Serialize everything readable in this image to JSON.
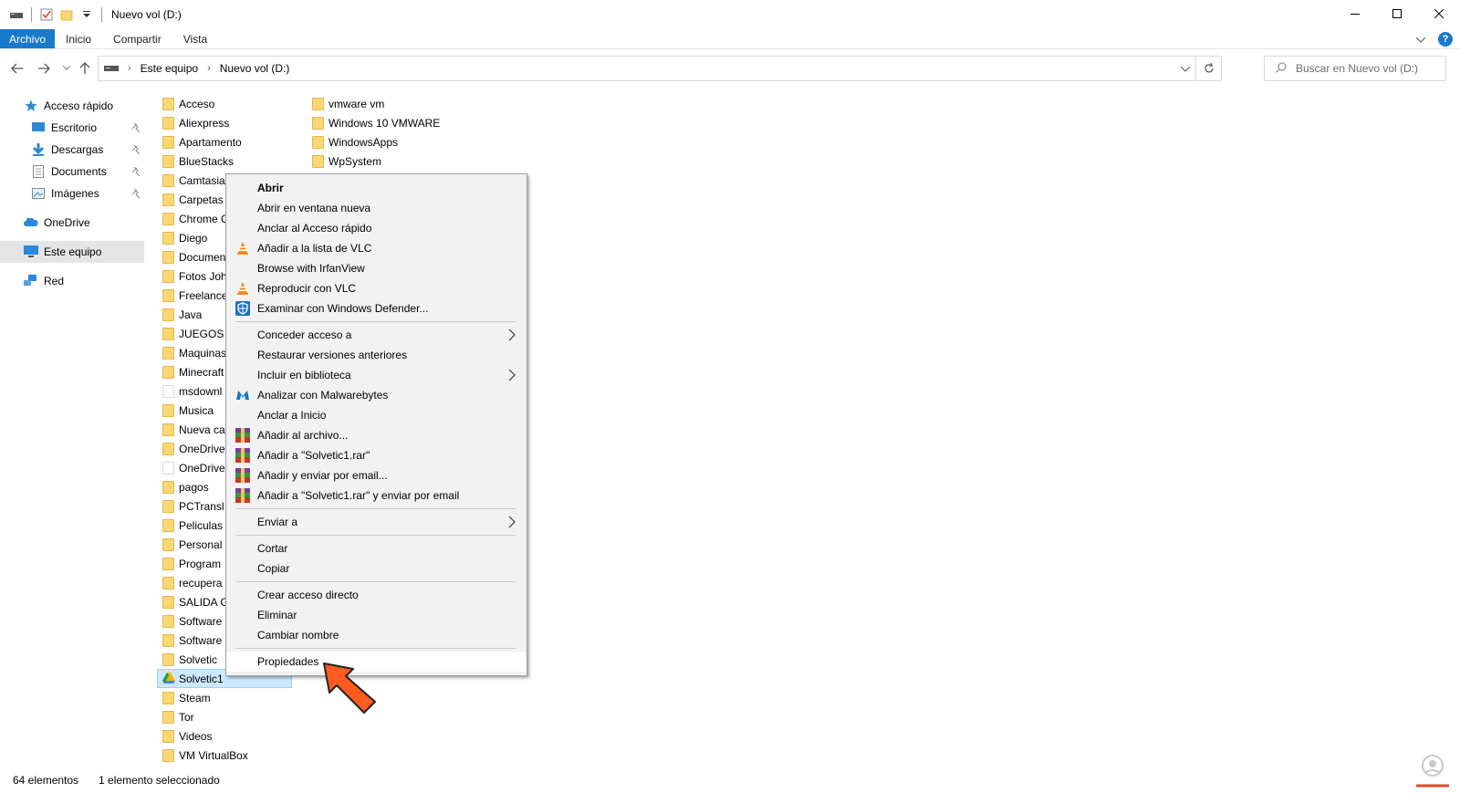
{
  "window": {
    "title": "Nuevo vol (D:)"
  },
  "ribbon": {
    "tabs": [
      "Archivo",
      "Inicio",
      "Compartir",
      "Vista"
    ],
    "help": "?"
  },
  "address": {
    "crumbs": [
      "Este equipo",
      "Nuevo vol (D:)"
    ],
    "search_placeholder": "Buscar en Nuevo vol (D:)"
  },
  "sidebar": {
    "items": [
      {
        "label": "Acceso rápido",
        "icon": "star-icon"
      },
      {
        "label": "Escritorio",
        "icon": "desktop-icon"
      },
      {
        "label": "Descargas",
        "icon": "download-icon"
      },
      {
        "label": "Documents",
        "icon": "document-icon"
      },
      {
        "label": "Imágenes",
        "icon": "pictures-icon"
      },
      {
        "label": "OneDrive",
        "icon": "cloud-icon"
      },
      {
        "label": "Este equipo",
        "icon": "computer-icon"
      },
      {
        "label": "Red",
        "icon": "network-icon"
      }
    ]
  },
  "files": {
    "col1": [
      "Acceso",
      "Aliexpress",
      "Apartamento",
      "BlueStacks",
      "Camtasia",
      "Carpetas",
      "Chrome C",
      "Diego",
      "Documen",
      "Fotos Joh",
      "Freelance",
      "Java",
      "JUEGOS",
      "Maquinas",
      "Minecraft",
      "msdownl",
      "Musica",
      "Nueva ca",
      "OneDrive",
      "OneDrive",
      "pagos",
      "PCTransl",
      "Peliculas",
      "Personal",
      "Program",
      "recupera",
      "SALIDA G",
      "Software",
      "Software",
      "Solvetic",
      "Solvetic1",
      "Steam",
      "Tor",
      "Videos",
      "VM VirtualBox"
    ],
    "col2": [
      "vmware vm",
      "Windows 10 VMWARE",
      "WindowsApps",
      "WpSystem"
    ],
    "selected": "Solvetic1"
  },
  "context_menu": {
    "groups": [
      [
        {
          "label": "Abrir",
          "bold": true
        },
        {
          "label": "Abrir en ventana nueva"
        },
        {
          "label": "Anclar al Acceso rápido"
        },
        {
          "label": "Añadir a la lista de VLC",
          "icon": "vlc-icon"
        },
        {
          "label": "Browse with IrfanView"
        },
        {
          "label": "Reproducir con VLC",
          "icon": "vlc-icon"
        },
        {
          "label": "Examinar con Windows Defender...",
          "icon": "defender-icon"
        }
      ],
      [
        {
          "label": "Conceder acceso a",
          "submenu": true
        },
        {
          "label": "Restaurar versiones anteriores"
        },
        {
          "label": "Incluir en biblioteca",
          "submenu": true
        },
        {
          "label": "Analizar con Malwarebytes",
          "icon": "malwarebytes-icon"
        },
        {
          "label": "Anclar a Inicio"
        },
        {
          "label": "Añadir al archivo...",
          "icon": "winrar-icon"
        },
        {
          "label": "Añadir a \"Solvetic1.rar\"",
          "icon": "winrar-icon"
        },
        {
          "label": "Añadir y enviar por email...",
          "icon": "winrar-icon"
        },
        {
          "label": "Añadir a \"Solvetic1.rar\" y enviar por email",
          "icon": "winrar-icon"
        }
      ],
      [
        {
          "label": "Enviar a",
          "submenu": true
        }
      ],
      [
        {
          "label": "Cortar"
        },
        {
          "label": "Copiar"
        }
      ],
      [
        {
          "label": "Crear acceso directo"
        },
        {
          "label": "Eliminar"
        },
        {
          "label": "Cambiar nombre"
        }
      ],
      [
        {
          "label": "Propiedades",
          "highlighted": true
        }
      ]
    ]
  },
  "status": {
    "count": "64 elementos",
    "selected": "1 elemento seleccionado"
  },
  "colors": {
    "accent": "#1979ca",
    "folder": "#f8d775",
    "selection": "#cce8ff",
    "arrow": "#ff5a1f"
  }
}
